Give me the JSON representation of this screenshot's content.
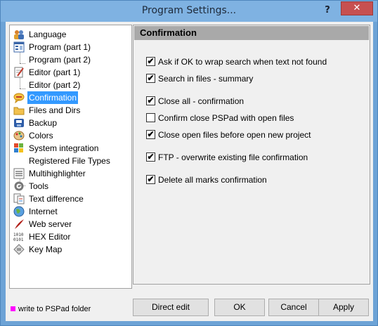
{
  "window": {
    "title": "Program Settings...",
    "help_label": "?",
    "close_label": "✕"
  },
  "tree": {
    "items": [
      {
        "label": "Language",
        "icon": "people-icon"
      },
      {
        "label": "Program  (part 1)",
        "icon": "program-icon"
      },
      {
        "label": "Program  (part 2)",
        "icon": ""
      },
      {
        "label": "Editor  (part 1)",
        "icon": "editor-icon"
      },
      {
        "label": "Editor  (part 2)",
        "icon": ""
      },
      {
        "label": "Confirmation",
        "icon": "speech-bubble-icon",
        "selected": true
      },
      {
        "label": "Files and Dirs",
        "icon": "folder-icon"
      },
      {
        "label": "Backup",
        "icon": "backup-icon"
      },
      {
        "label": "Colors",
        "icon": "palette-icon"
      },
      {
        "label": "System integration",
        "icon": "windows-icon"
      },
      {
        "label": "Registered File Types",
        "icon": ""
      },
      {
        "label": "Multihighlighter",
        "icon": "highlighter-icon"
      },
      {
        "label": "Tools",
        "icon": "tools-icon"
      },
      {
        "label": "Text difference",
        "icon": "text-diff-icon"
      },
      {
        "label": "Internet",
        "icon": "globe-icon"
      },
      {
        "label": "Web server",
        "icon": "feather-icon"
      },
      {
        "label": "HEX Editor",
        "icon": "hex-icon"
      },
      {
        "label": "Key Map",
        "icon": "keymap-icon"
      }
    ]
  },
  "panel": {
    "header": "Confirmation",
    "options": [
      {
        "label": "Ask if OK to wrap search when text not found",
        "checked": true
      },
      {
        "label": "Search in files - summary",
        "checked": true
      },
      {
        "label": "Close all - confirmation",
        "checked": true
      },
      {
        "label": "Confirm close PSPad with open files",
        "checked": false
      },
      {
        "label": "Close open files before open new project",
        "checked": true
      },
      {
        "label": "FTP - overwrite existing file confirmation",
        "checked": true
      },
      {
        "label": "Delete all marks confirmation",
        "checked": true
      }
    ]
  },
  "footer": {
    "folder_note": "write to PSPad folder",
    "swatch_color": "#ff00ff",
    "buttons": {
      "direct_edit": "Direct edit",
      "ok": "OK",
      "cancel": "Cancel",
      "apply": "Apply"
    }
  }
}
